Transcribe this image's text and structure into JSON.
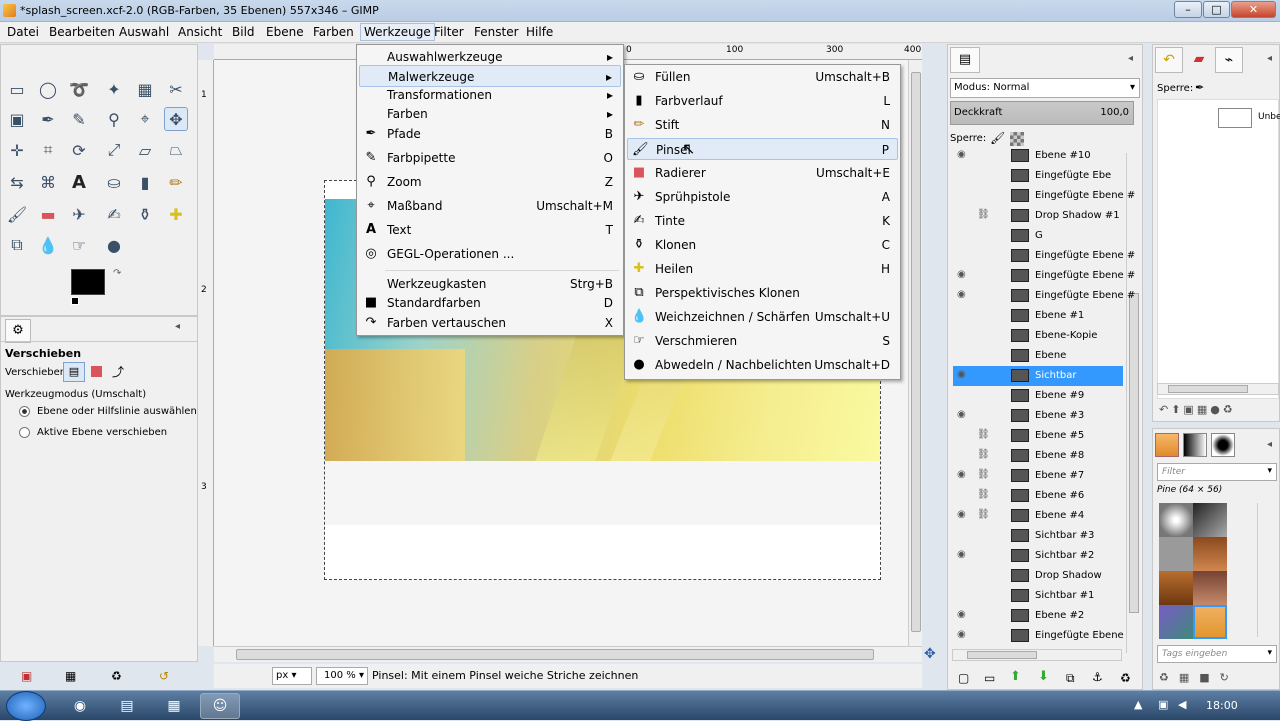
{
  "window": {
    "title": "*splash_screen.xcf-2.0 (RGB-Farben, 35 Ebenen) 557x346 – GIMP"
  },
  "menubar": [
    "Datei",
    "Bearbeiten",
    "Auswahl",
    "Ansicht",
    "Bild",
    "Ebene",
    "Farben",
    "Werkzeuge",
    "Filter",
    "Fenster",
    "Hilfe"
  ],
  "tools_menu": {
    "items": [
      {
        "label": "Auswahlwerkzeuge",
        "shortcut": "▸"
      },
      {
        "label": "Malwerkzeuge",
        "shortcut": "▸"
      },
      {
        "label": "Transformationen",
        "shortcut": "▸"
      },
      {
        "label": "Farben",
        "shortcut": "▸"
      },
      {
        "label": "Pfade",
        "shortcut": "B"
      },
      {
        "label": "Farbpipette",
        "shortcut": "O"
      },
      {
        "label": "Zoom",
        "shortcut": "Z"
      },
      {
        "label": "Maßband",
        "shortcut": "Umschalt+M"
      },
      {
        "label": "Text",
        "shortcut": "T"
      },
      {
        "label": "GEGL-Operationen ...",
        "shortcut": ""
      },
      {
        "label": "Werkzeugkasten",
        "shortcut": "Strg+B"
      },
      {
        "label": "Standardfarben",
        "shortcut": "D"
      },
      {
        "label": "Farben vertauschen",
        "shortcut": "X"
      }
    ]
  },
  "paint_menu": {
    "items": [
      {
        "label": "Füllen",
        "shortcut": "Umschalt+B"
      },
      {
        "label": "Farbverlauf",
        "shortcut": "L"
      },
      {
        "label": "Stift",
        "shortcut": "N"
      },
      {
        "label": "Pinsel",
        "shortcut": "P"
      },
      {
        "label": "Radierer",
        "shortcut": "Umschalt+E"
      },
      {
        "label": "Sprühpistole",
        "shortcut": "A"
      },
      {
        "label": "Tinte",
        "shortcut": "K"
      },
      {
        "label": "Klonen",
        "shortcut": "C"
      },
      {
        "label": "Heilen",
        "shortcut": "H"
      },
      {
        "label": "Perspektivisches Klonen",
        "shortcut": ""
      },
      {
        "label": "Weichzeichnen / Schärfen",
        "shortcut": "Umschalt+U"
      },
      {
        "label": "Verschmieren",
        "shortcut": "S"
      },
      {
        "label": "Abwedeln / Nachbelichten",
        "shortcut": "Umschalt+D"
      }
    ]
  },
  "ruler": {
    "h": [
      "0",
      "100",
      "300",
      "400"
    ],
    "v": [
      "1",
      "2",
      "3"
    ]
  },
  "tool_options": {
    "title": "Verschieben",
    "move_label": "Verschieben:",
    "mode_label": "Werkzeugmodus (Umschalt)",
    "radio1": "Ebene oder Hilfslinie auswählen",
    "radio2": "Aktive Ebene verschieben"
  },
  "layers_panel": {
    "mode_label": "Modus: Normal",
    "opacity_label": "Deckkraft",
    "opacity_value": "100,0",
    "lock_label": "Sperre:",
    "layers": [
      {
        "name": "Ebene #10",
        "eye": true,
        "chain": false
      },
      {
        "name": "Eingefügte Ebe",
        "eye": false,
        "chain": false
      },
      {
        "name": "Eingefügte Ebene #",
        "eye": false,
        "chain": false
      },
      {
        "name": "Drop Shadow #1",
        "eye": false,
        "chain": true
      },
      {
        "name": "G",
        "eye": false,
        "chain": false
      },
      {
        "name": "Eingefügte Ebene #",
        "eye": false,
        "chain": false
      },
      {
        "name": "Eingefügte Ebene #",
        "eye": true,
        "chain": false
      },
      {
        "name": "Eingefügte Ebene #",
        "eye": true,
        "chain": false
      },
      {
        "name": "Ebene #1",
        "eye": false,
        "chain": false
      },
      {
        "name": "Ebene-Kopie",
        "eye": false,
        "chain": false
      },
      {
        "name": "Ebene",
        "eye": false,
        "chain": false
      },
      {
        "name": "Sichtbar",
        "eye": true,
        "chain": false,
        "selected": true
      },
      {
        "name": "Ebene #9",
        "eye": false,
        "chain": false
      },
      {
        "name": "Ebene #3",
        "eye": true,
        "chain": false
      },
      {
        "name": "Ebene #5",
        "eye": false,
        "chain": true
      },
      {
        "name": "Ebene #8",
        "eye": false,
        "chain": true
      },
      {
        "name": "Ebene #7",
        "eye": true,
        "chain": true
      },
      {
        "name": "Ebene #6",
        "eye": false,
        "chain": true
      },
      {
        "name": "Ebene #4",
        "eye": true,
        "chain": true
      },
      {
        "name": "Sichtbar #3",
        "eye": false,
        "chain": false
      },
      {
        "name": "Sichtbar #2",
        "eye": true,
        "chain": false
      },
      {
        "name": "Drop Shadow",
        "eye": false,
        "chain": false
      },
      {
        "name": "Sichtbar #1",
        "eye": false,
        "chain": false
      },
      {
        "name": "Ebene #2",
        "eye": true,
        "chain": false
      },
      {
        "name": "Eingefügte Ebene",
        "eye": true,
        "chain": false
      }
    ]
  },
  "undo_panel": {
    "lock_label": "Sperre:",
    "item": "Unbe"
  },
  "brushes_panel": {
    "filter_placeholder": "Filter",
    "brush_name": "Pine (64 × 56)",
    "tags_placeholder": "Tags eingeben"
  },
  "status": {
    "unit": "px",
    "zoom": "100 %",
    "message": "Pinsel: Mit einem Pinsel weiche Striche zeichnen"
  },
  "taskbar": {
    "clock": "18:00"
  }
}
